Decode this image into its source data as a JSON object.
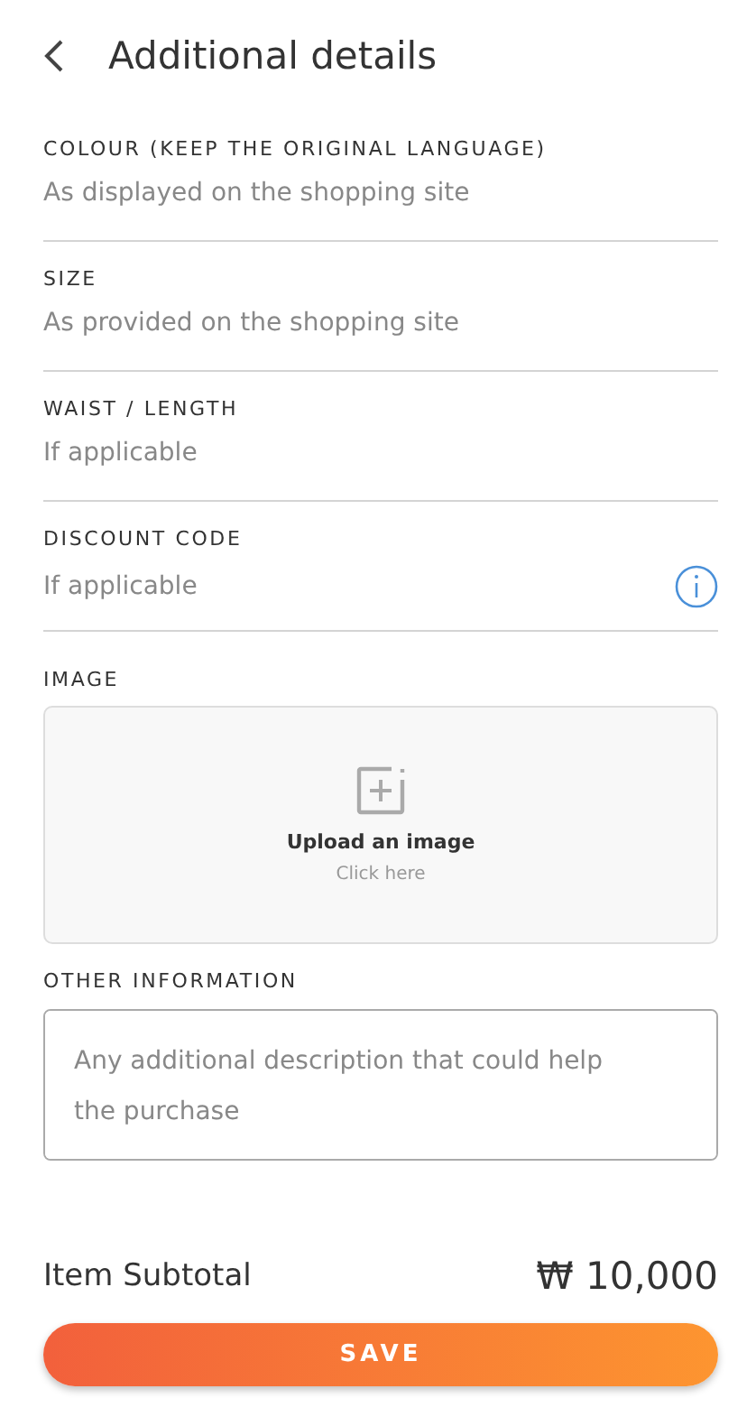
{
  "header": {
    "title": "Additional details"
  },
  "fields": [
    {
      "label": "COLOUR (KEEP THE ORIGINAL LANGUAGE)",
      "placeholder": "As displayed on the shopping site",
      "info": false
    },
    {
      "label": "SIZE",
      "placeholder": "As provided on the shopping site",
      "info": false
    },
    {
      "label": "WAIST / LENGTH",
      "placeholder": "If applicable",
      "info": false
    },
    {
      "label": "DISCOUNT CODE",
      "placeholder": "If applicable",
      "info": true
    }
  ],
  "image": {
    "label": "IMAGE",
    "title": "Upload an image",
    "hint": "Click here"
  },
  "other": {
    "label": "OTHER INFORMATION",
    "placeholder": "Any additional description that could help the purchase"
  },
  "subtotal": {
    "label": "Item Subtotal",
    "value": "₩ 10,000"
  },
  "save": "SAVE"
}
